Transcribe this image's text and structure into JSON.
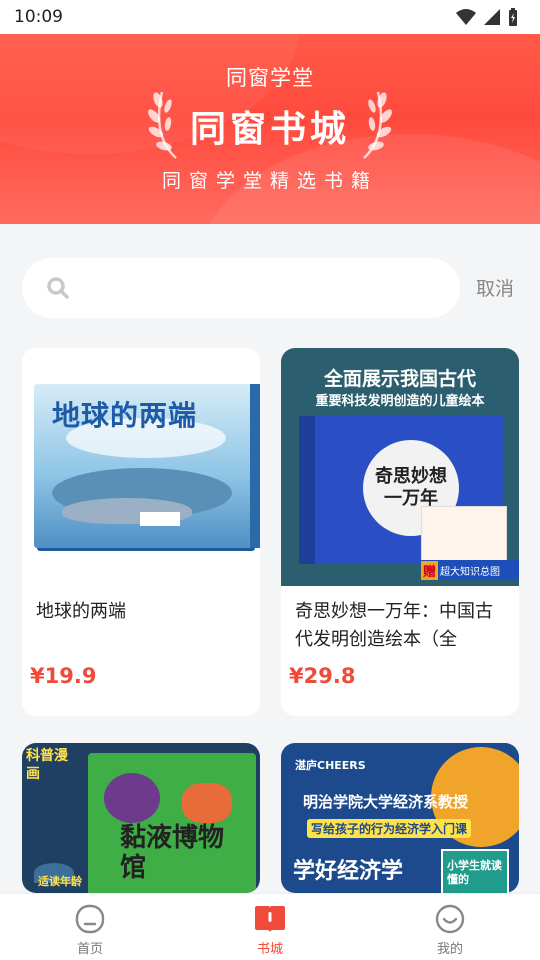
{
  "status_bar": {
    "time": "10:09"
  },
  "banner": {
    "subtitle": "同窗学堂",
    "title": "同窗书城",
    "tagline": "同窗学堂精选书籍"
  },
  "search": {
    "value": "",
    "placeholder": "",
    "cancel_label": "取消"
  },
  "books": [
    {
      "title": "地球的两端",
      "price": "¥19.9",
      "cover_text": "地球的两端"
    },
    {
      "title": "奇思妙想一万年：中国古代发明创造绘本（全",
      "price": "¥29.8",
      "cover_headline1": "全面展示我国古代",
      "cover_headline2": "重要科技发明创造的儿童绘本",
      "cover_text": "奇思妙想一万年",
      "cover_badge": "赠",
      "cover_badge_text": "超大知识总图"
    },
    {
      "title": "",
      "price": "",
      "cover_tag": "科普漫画",
      "cover_text": "黏液博物馆",
      "cover_bottom": "适读年龄"
    },
    {
      "title": "",
      "price": "",
      "cover_brand": "湛庐CHEERS",
      "cover_line1": "明治学院大学经济系教授",
      "cover_line2": "写给孩子的行为经济学入门课",
      "cover_line3": "学好经济学",
      "cover_side": "小学生就读懂的"
    }
  ],
  "tabs": [
    {
      "label": "首页",
      "icon": "home-face-icon",
      "active": false
    },
    {
      "label": "书城",
      "icon": "book-icon",
      "active": true
    },
    {
      "label": "我的",
      "icon": "smile-icon",
      "active": false
    }
  ],
  "colors": {
    "accent": "#f04a3a",
    "banner": "#ff4a3e",
    "background": "#f4f5f7"
  }
}
